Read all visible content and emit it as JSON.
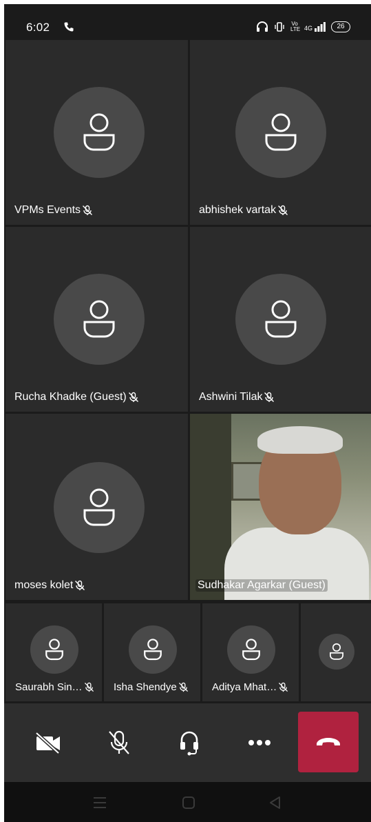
{
  "status_bar": {
    "time": "6:02",
    "network": "4G",
    "volte": "Vo LTE",
    "battery": "26"
  },
  "participants": {
    "large": [
      {
        "name": "VPMs Events",
        "muted": true
      },
      {
        "name": "abhishek vartak",
        "muted": true
      },
      {
        "name": "Rucha Khadke (Guest)",
        "muted": true
      },
      {
        "name": "Ashwini Tilak",
        "muted": true
      },
      {
        "name": "moses kolet",
        "muted": true
      },
      {
        "name": "Sudhakar Agarkar (Guest)",
        "muted": false,
        "video": true
      }
    ],
    "small": [
      {
        "name": "Saurabh Sin…",
        "muted": true
      },
      {
        "name": "Isha Shendye",
        "muted": true
      },
      {
        "name": "Aditya Mhat…",
        "muted": true
      },
      {
        "name": "",
        "muted": false
      }
    ]
  },
  "controls": {
    "camera": "video-off-icon",
    "mic": "mic-off-icon",
    "audio": "headset-icon",
    "more": "more-icon",
    "end": "hang-up-icon",
    "end_color": "#b0223f"
  }
}
